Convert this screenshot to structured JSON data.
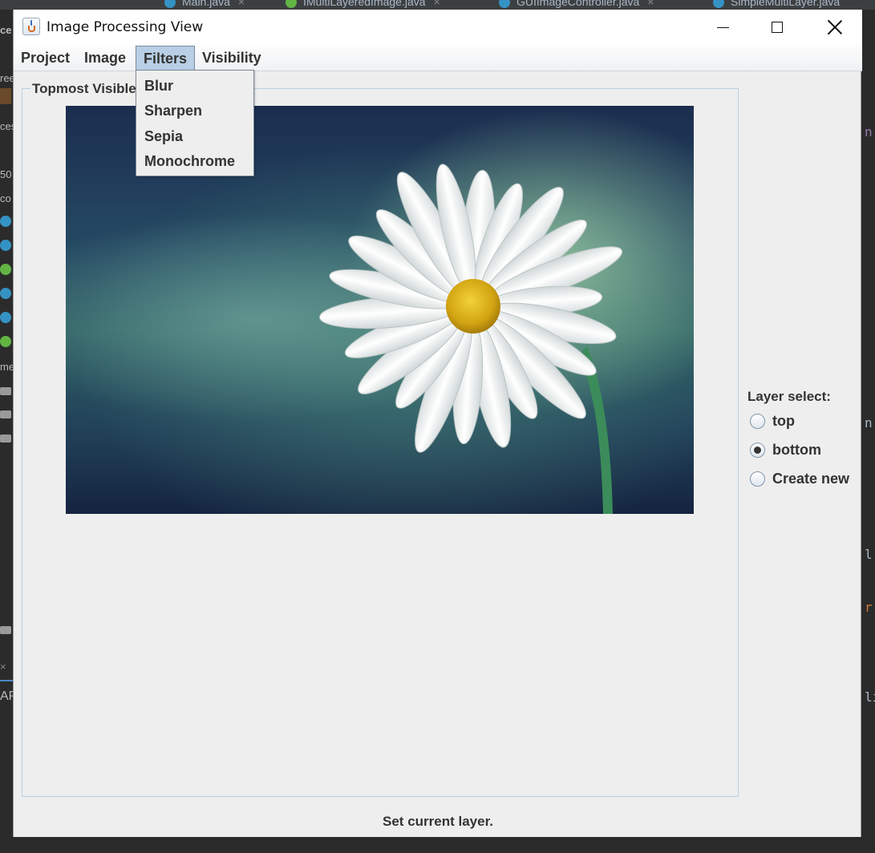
{
  "ide": {
    "tabs": [
      {
        "label": "Main.java",
        "badge": "C",
        "color": "#3592c4"
      },
      {
        "label": "IMultiLayeredImage.java",
        "badge": "I",
        "color": "#62b543"
      },
      {
        "label": "GUIImageController.java",
        "badge": "C",
        "color": "#3592c4"
      },
      {
        "label": "SimpleMultiLayer.java",
        "badge": "C",
        "color": "#3592c4"
      }
    ],
    "left_fragments": [
      "ce",
      "ree",
      "ces",
      "50",
      "co",
      "me",
      "AP"
    ],
    "right_fragments": [
      "n",
      "n",
      "l",
      "r",
      "li"
    ]
  },
  "window": {
    "title": "Image Processing View",
    "icon": "java-cup-icon"
  },
  "menubar": {
    "project": "Project",
    "image": "Image",
    "filters": "Filters",
    "visibility": "Visibility"
  },
  "filters_menu": {
    "items": [
      "Blur",
      "Sharpen",
      "Sepia",
      "Monochrome"
    ]
  },
  "panel": {
    "title": "Topmost Visible"
  },
  "layer_select": {
    "label": "Layer select:",
    "options": [
      {
        "label": "top",
        "checked": false
      },
      {
        "label": "bottom",
        "checked": true
      },
      {
        "label": "Create new",
        "checked": false
      }
    ]
  },
  "status": {
    "text": "Set current layer."
  },
  "colors": {
    "menu_selected": "#b8cfe5",
    "window_bg": "#eeeeee",
    "ide_bg": "#2b2b2b"
  }
}
